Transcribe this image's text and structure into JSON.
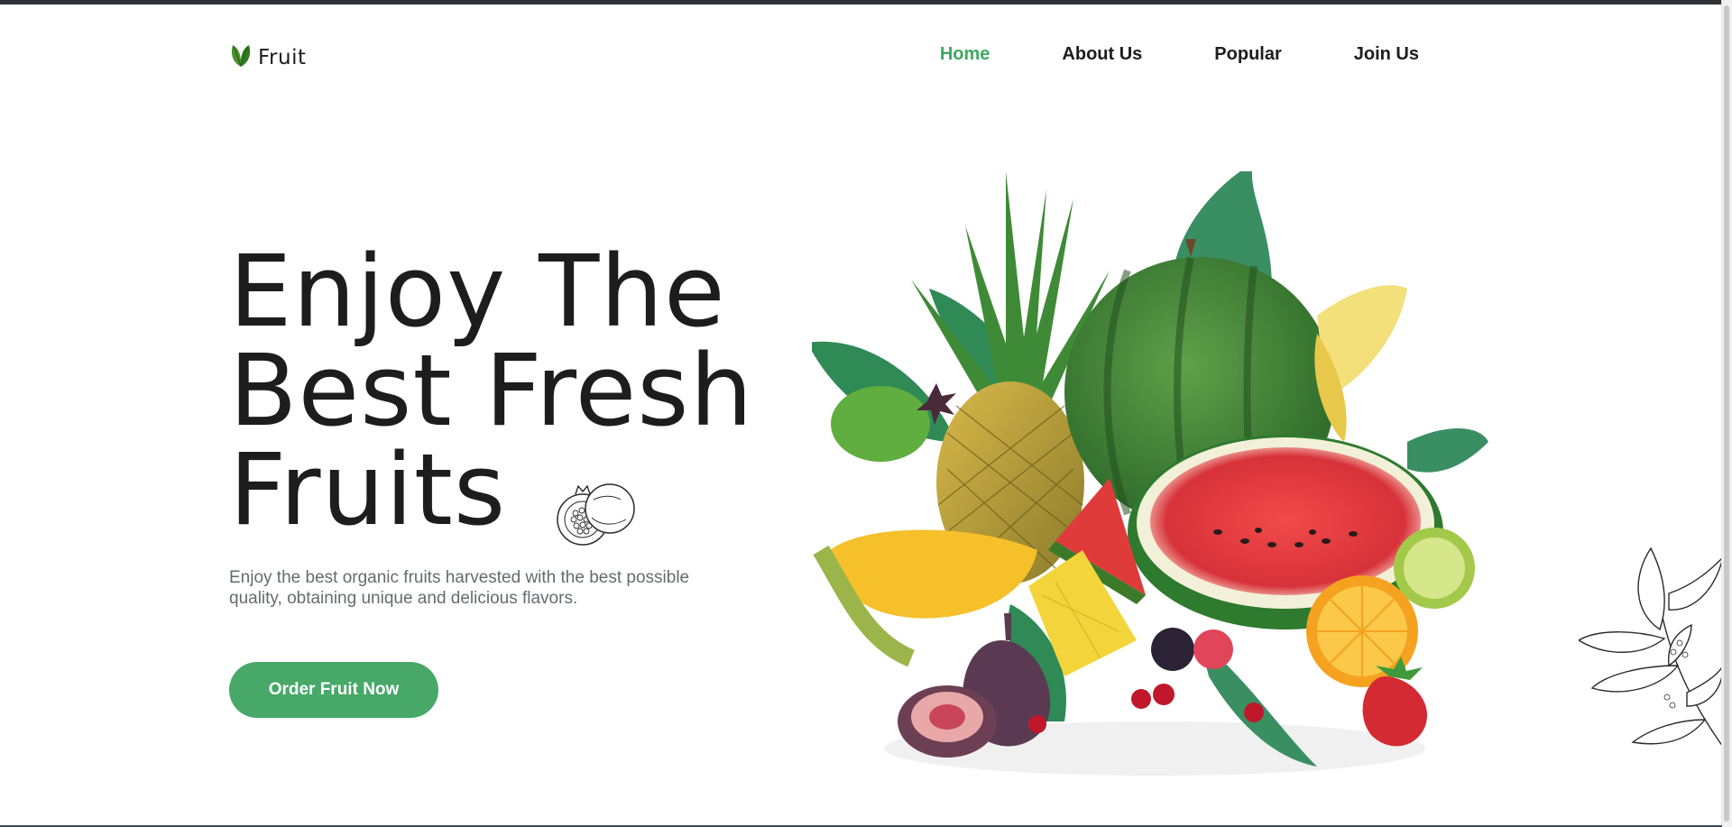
{
  "brand": {
    "name": "Fruit",
    "logo_icon": "leaf-icon"
  },
  "nav": {
    "items": [
      {
        "label": "Home",
        "active": true
      },
      {
        "label": "About Us",
        "active": false
      },
      {
        "label": "Popular",
        "active": false
      },
      {
        "label": "Join Us",
        "active": false
      }
    ]
  },
  "hero": {
    "title_lines": [
      "Enjoy The",
      "Best Fresh",
      "Fruits"
    ],
    "description": "Enjoy the best organic fruits harvested with the best possible quality, obtaining unique and delicious flavors.",
    "cta_label": "Order Fruit Now",
    "decorations": [
      "pomegranate-sketch-icon",
      "fruit-composition-image",
      "leaf-branch-sketch-icon"
    ]
  },
  "colors": {
    "accent": "#47a868",
    "nav_active": "#3da860",
    "text_dark": "#1d1d1d",
    "text_muted": "#666b70",
    "top_strip": "#2f3337"
  }
}
